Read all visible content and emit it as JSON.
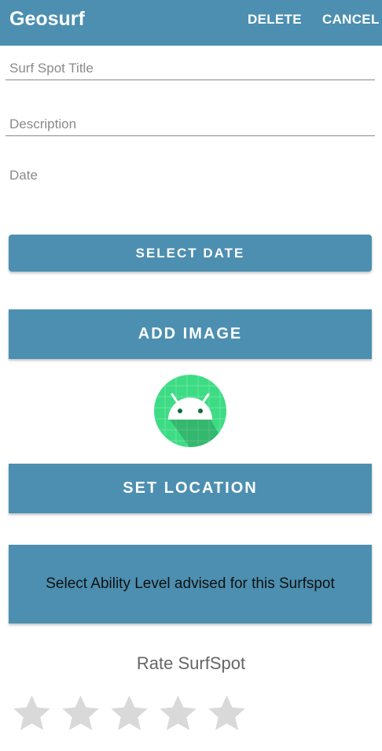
{
  "appbar": {
    "title": "Geosurf",
    "actions": {
      "delete_label": "DELETE",
      "cancel_label": "CANCEL"
    },
    "color": "#4c8fb0"
  },
  "form": {
    "title_placeholder": "Surf Spot Title",
    "title_value": "",
    "description_placeholder": "Description",
    "description_value": "",
    "date_label": "Date"
  },
  "buttons": {
    "select_date": "SELECT DATE",
    "add_image": "ADD IMAGE",
    "set_location": "SET LOCATION",
    "ability": "Select Ability Level advised for this Surfspot"
  },
  "image_preview": {
    "icon": "android-icon"
  },
  "rating": {
    "label": "Rate SurfSpot",
    "max_stars": 5,
    "value": 0,
    "star_color_empty": "#d9d9d9"
  }
}
